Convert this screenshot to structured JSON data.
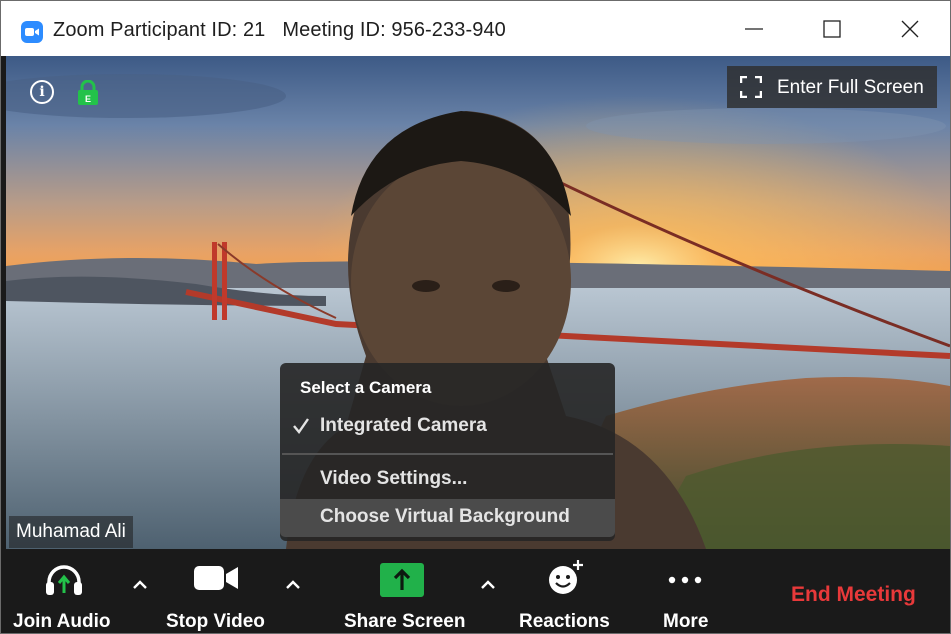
{
  "window": {
    "title": "Zoom Participant ID: 21   Meeting ID: 956-233-940",
    "controls": {
      "minimize": "minimize",
      "maximize": "maximize",
      "close": "close"
    }
  },
  "video": {
    "fullscreen_label": "Enter Full Screen",
    "participant_name": "Muhamad Ali",
    "lock_letter": "E"
  },
  "camera_menu": {
    "header": "Select a Camera",
    "items": [
      {
        "label": "Integrated Camera",
        "checked": true
      },
      {
        "label": "Video Settings...",
        "checked": false
      },
      {
        "label": "Choose Virtual Background",
        "checked": false,
        "highlighted": true
      }
    ]
  },
  "toolbar": {
    "join_audio": "Join Audio",
    "stop_video": "Stop Video",
    "share_screen": "Share Screen",
    "reactions": "Reactions",
    "more": "More",
    "end_meeting": "End Meeting"
  },
  "colors": {
    "accent": "#2d8cff",
    "share_green": "#21b14a",
    "end_red": "#e8393a",
    "toolbar_bg": "#1a1a1a"
  }
}
